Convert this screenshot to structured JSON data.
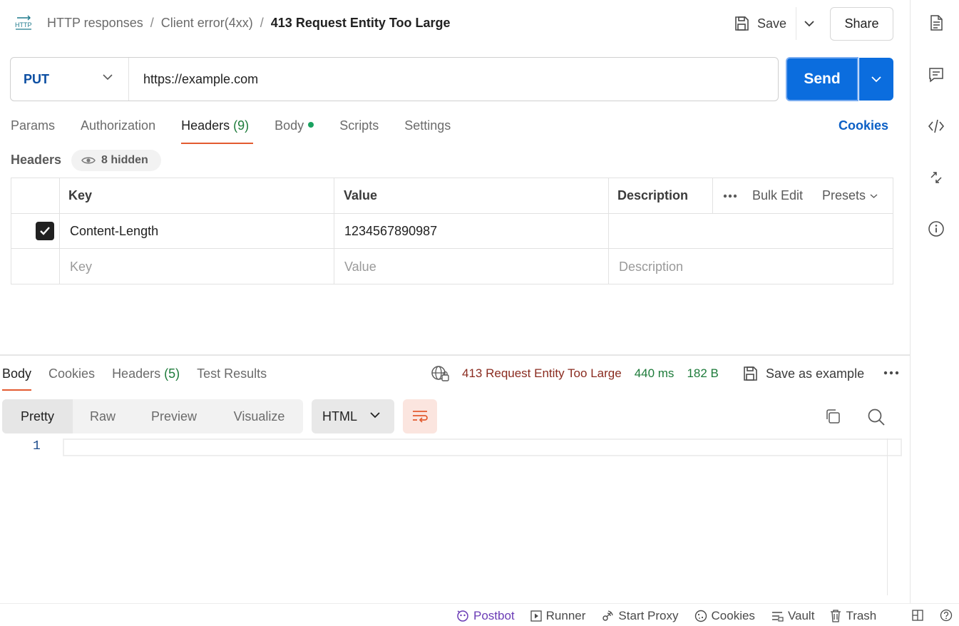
{
  "header": {
    "breadcrumb": [
      "HTTP responses",
      "Client error(4xx)"
    ],
    "current": "413 Request Entity Too Large",
    "save_label": "Save",
    "share_label": "Share"
  },
  "request": {
    "method": "PUT",
    "url": "https://example.com",
    "send_label": "Send"
  },
  "req_tabs": [
    {
      "label": "Params"
    },
    {
      "label": "Authorization"
    },
    {
      "label": "Headers",
      "count": "(9)"
    },
    {
      "label": "Body"
    },
    {
      "label": "Scripts"
    },
    {
      "label": "Settings"
    }
  ],
  "cookies_link": "Cookies",
  "headers_section": {
    "title": "Headers",
    "hidden": "8 hidden",
    "columns": [
      "Key",
      "Value",
      "Description"
    ],
    "bulk_edit": "Bulk Edit",
    "presets": "Presets",
    "row": {
      "key": "Content-Length",
      "value": "1234567890987",
      "checked": true
    },
    "placeholders": {
      "key": "Key",
      "value": "Value",
      "description": "Description"
    }
  },
  "res_tabs": [
    {
      "label": "Body"
    },
    {
      "label": "Cookies"
    },
    {
      "label": "Headers",
      "count": "(5)"
    },
    {
      "label": "Test Results"
    }
  ],
  "response": {
    "status": "413 Request Entity Too Large",
    "time": "440 ms",
    "size": "182 B",
    "save_example": "Save as example"
  },
  "body_views": [
    "Pretty",
    "Raw",
    "Preview",
    "Visualize"
  ],
  "language": "HTML",
  "code": {
    "line_number": "1"
  },
  "footer": {
    "postbot": "Postbot",
    "runner": "Runner",
    "start_proxy": "Start Proxy",
    "cookies": "Cookies",
    "vault": "Vault",
    "trash": "Trash"
  },
  "colors": {
    "accent": "#0b6dde",
    "tab_underline": "#e35b30",
    "status_error": "#8a2b1f",
    "ok_green": "#1d7b3a"
  }
}
